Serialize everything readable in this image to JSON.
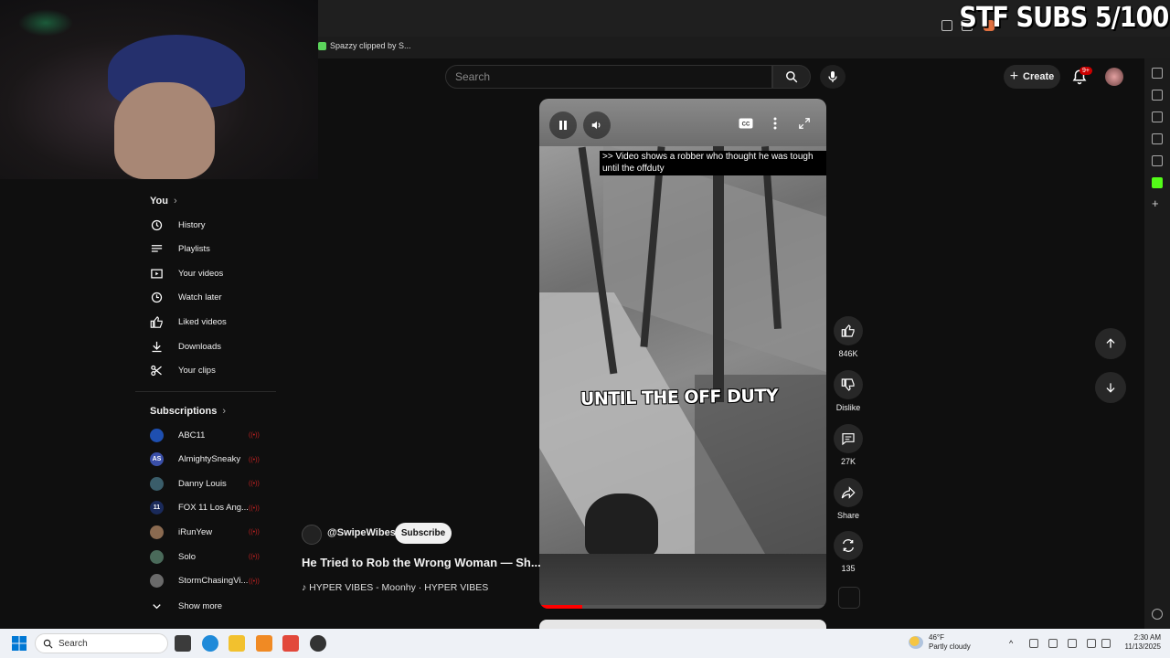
{
  "overlay": {
    "stream_counter": "STF SUBS 5/100"
  },
  "browser": {
    "bookmark": "Spazzy clipped by S..."
  },
  "header": {
    "search_placeholder": "Search",
    "create_label": "Create",
    "notifications_badge": "9+"
  },
  "sidebar": {
    "you_title": "You",
    "you_items": [
      {
        "label": "History",
        "icon": "history-icon"
      },
      {
        "label": "Playlists",
        "icon": "playlists-icon"
      },
      {
        "label": "Your videos",
        "icon": "your-videos-icon"
      },
      {
        "label": "Watch later",
        "icon": "watch-later-icon"
      },
      {
        "label": "Liked videos",
        "icon": "like-icon"
      },
      {
        "label": "Downloads",
        "icon": "download-icon"
      },
      {
        "label": "Your clips",
        "icon": "scissors-icon"
      }
    ],
    "subs_title": "Subscriptions",
    "subscriptions": [
      {
        "label": "ABC11",
        "avatar_color": "#1e4fb0",
        "avatar_text": ""
      },
      {
        "label": "AlmightySneaky",
        "avatar_color": "#3a4fa8",
        "avatar_text": "AS"
      },
      {
        "label": "Danny Louis",
        "avatar_color": "#3a5d6a",
        "avatar_text": ""
      },
      {
        "label": "FOX 11 Los Ang...",
        "avatar_color": "#1a2a5a",
        "avatar_text": "11"
      },
      {
        "label": "iRunYew",
        "avatar_color": "#8a6a50",
        "avatar_text": ""
      },
      {
        "label": "Solo",
        "avatar_color": "#4a6a5a",
        "avatar_text": ""
      },
      {
        "label": "StormChasingVi...",
        "avatar_color": "#6a6a6a",
        "avatar_text": ""
      }
    ],
    "show_more": "Show more",
    "live_color": "#c22222"
  },
  "video": {
    "caption": ">> Video shows a robber who thought he was tough until the offduty",
    "overlay_text": "UNTIL THE OFF DUTY",
    "progress": 0.15,
    "channel": "@SwipeWibes",
    "subscribe_label": "Subscribe",
    "title": "He Tried to Rob the Wrong Woman — Sh...",
    "music": "HYPER VIBES - Moonhy · HYPER VIBES"
  },
  "actions": {
    "likes": "846K",
    "dislike": "Dislike",
    "comments": "27K",
    "share": "Share",
    "remix": "135"
  },
  "taskbar": {
    "search": "Search",
    "temp": "46°F",
    "weather": "Partly cloudy",
    "time": "2:30 AM",
    "date": "11/13/2025"
  }
}
